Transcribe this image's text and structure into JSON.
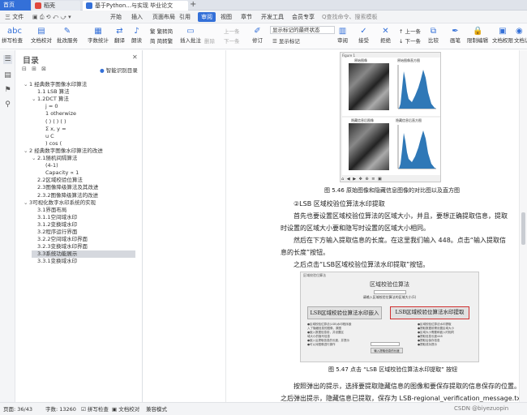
{
  "tabs": {
    "home": "首页",
    "t2": "稻壳",
    "t3": "基于Python...与实现 毕业论文"
  },
  "menu": {
    "file": "三 文件",
    "items": [
      "开始",
      "插入",
      "页面布局",
      "引用",
      "审阅",
      "视图",
      "章节",
      "开发工具",
      "会员专享"
    ],
    "active_index": 4,
    "search": "Q查找命令、搜索模板"
  },
  "ribbon": {
    "spellcheck": "拼写检查",
    "doc_check": "文档校对",
    "batch_review": "批改服务",
    "word_count": "字数统计",
    "translate": "翻译",
    "read": "朗读",
    "trad_simp": "繁转简",
    "simp_trad": "简转繁",
    "insert_comment": "插入批注",
    "delete": "删除",
    "prev1": "上一条",
    "next1": "下一条",
    "revise": "修订",
    "markup_state": "显示标记的最终状态",
    "show_markup": "显示标记",
    "review": "审阅",
    "accept": "接受",
    "reject": "拒绝",
    "prev2": "上一条",
    "next2": "下一条",
    "compare": "比较",
    "restrict": "画笔",
    "restrict_edit": "限制编辑",
    "doc_perm": "文档权限",
    "doc_cert": "文档认证"
  },
  "toc": {
    "title": "目录",
    "smart": "智能识别目录",
    "items": [
      {
        "text": "1 经典数字图像水印算法",
        "level": 0,
        "arrow": "⌄"
      },
      {
        "text": "1.1 LSB 算法",
        "level": 1,
        "arrow": ""
      },
      {
        "text": "1.2DCT 算法",
        "level": 1,
        "arrow": "⌄"
      },
      {
        "text": "j = 0",
        "level": 2,
        "arrow": ""
      },
      {
        "text": "1 otherwize",
        "level": 2,
        "arrow": ""
      },
      {
        "text": "( ) ( ) ( )",
        "level": 2,
        "arrow": ""
      },
      {
        "text": "Σ x, y =",
        "level": 2,
        "arrow": ""
      },
      {
        "text": "u C",
        "level": 2,
        "arrow": ""
      },
      {
        "text": ") cos (",
        "level": 2,
        "arrow": ""
      },
      {
        "text": "2 经典数字图像水印算法的改进",
        "level": 0,
        "arrow": "⌄"
      },
      {
        "text": "2.1随机间隔算法",
        "level": 1,
        "arrow": "⌄"
      },
      {
        "text": "(4-1)",
        "level": 2,
        "arrow": ""
      },
      {
        "text": "Capacity ∝ 1",
        "level": 2,
        "arrow": ""
      },
      {
        "text": "2.2区域校验位算法",
        "level": 1,
        "arrow": ""
      },
      {
        "text": "2.3图像降级算法及其改进",
        "level": 1,
        "arrow": ""
      },
      {
        "text": "2.3.2图像降级算法的改进",
        "level": 1,
        "arrow": ""
      },
      {
        "text": "3可视化数字水印系统的实现",
        "level": 0,
        "arrow": "⌄"
      },
      {
        "text": "3.1界面布局",
        "level": 1,
        "arrow": ""
      },
      {
        "text": "3.1.1空间域水印",
        "level": 1,
        "arrow": ""
      },
      {
        "text": "3.1.2变换域水印",
        "level": 1,
        "arrow": ""
      },
      {
        "text": "3.2程序运行界面",
        "level": 1,
        "arrow": ""
      },
      {
        "text": "3.2.2空间域水印界面",
        "level": 1,
        "arrow": ""
      },
      {
        "text": "3.2.3变换域水印界面",
        "level": 1,
        "arrow": ""
      },
      {
        "text": "3.3系统功能展示",
        "level": 1,
        "arrow": "",
        "selected": true
      },
      {
        "text": "3.3.1变换域水印",
        "level": 1,
        "arrow": ""
      }
    ]
  },
  "doc": {
    "fig1_window": "Figure 1",
    "fig1_panels": [
      "原始图像",
      "原始图像直方图",
      "隐藏信息后图像",
      "隐藏信息后直方图"
    ],
    "fig1_caption": "图 5.46   原始图像和隐藏信息图像的对比图以及直方图",
    "section": "②LSB 区域校验位算法水印提取",
    "p1a": "首先也要设置区域校验位算法的区域大小，并且，要想正确提取信息，提取",
    "p1b": "时设置的区域大小要和隐写时设置的区域大小相同。",
    "p2a": "然后在下方输入提取信息的长度。在这里我们输入 448。点击“输入提取信",
    "p2b": "息的长度”按钮。",
    "p3": "之后点击“LSB区域校验位算法水印提取”按钮。",
    "fig2_window": "区域校验位算法",
    "fig2_head": "区域校验位算法",
    "fig2_prompt": "请输入区域校验位算法的区域大小(1)",
    "fig2_btn_embed": "LSB区域校验位算法水印嵌入",
    "fig2_btn_extract": "LSB区域校验位算法水印提取",
    "fig2_left_lines": [
      "●区域校验位算法(LSB)水印程序嵌",
      "入了隐藏信息的图像，原图",
      "●嵌入数据信息前，并设置区",
      "域大小的隐写信息",
      "●嵌入后提取信息的长度，并提示",
      "●可以对图像进行操作"
    ],
    "fig2_right_lines": [
      "●区域校验位算法水印提取",
      "●提取数据前需设置区域大小",
      "●区域大小需要和嵌入时相同",
      "●提取信息长度448",
      "●提取后保存信息",
      "●提取成功提示"
    ],
    "fig2_input_btn": "输入提取信息的长度",
    "fig2_caption": "图 5.47   点击 “LSB 区域校验位算法水印提取” 按钮",
    "p4": "按照弹出的提示，选择要提取隐藏信息的图像和要保存提取的信息保存的位置。",
    "p5": "之后弹出提示，隐藏信息已提取，保存为 LSB-regional_verification_message.txt，直到"
  },
  "status": {
    "page": "页面: 36/43",
    "words": "字数: 13260",
    "spell": "拼写检查",
    "check": "文档校对",
    "mode": "兼容模式"
  },
  "watermark": "CSDN @biyezuopin",
  "colors": {
    "accent": "#3470d8",
    "hist": "#2f78b7",
    "highlight": "#d03030"
  }
}
